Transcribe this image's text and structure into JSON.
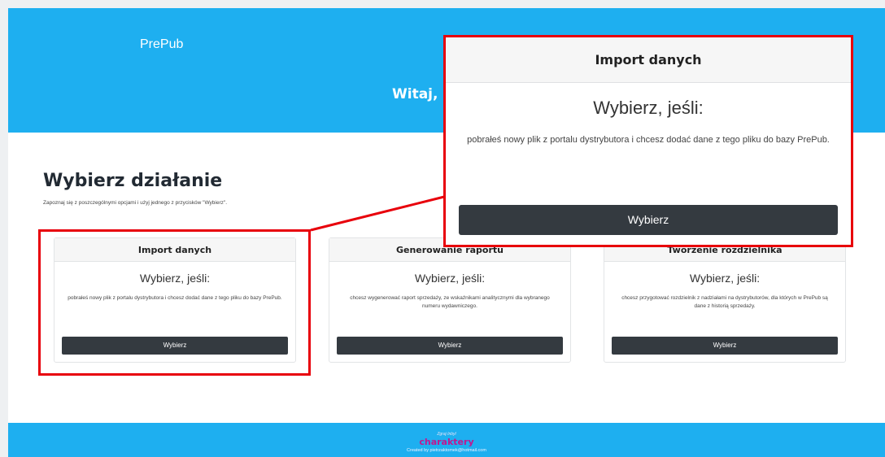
{
  "header": {
    "brand": "PrePub",
    "welcome": "Witaj,"
  },
  "section": {
    "title": "Wybierz działanie",
    "subtitle": "Zapoznaj się z poszczególnymi opcjami i użyj jednego z przycisków \"Wybierz\"."
  },
  "cards": [
    {
      "title": "Import danych",
      "lead": "Wybierz, jeśli:",
      "text": "pobrałeś nowy plik z portalu dystrybutora i chcesz dodać dane z tego pliku do bazy PrePub.",
      "button": "Wybierz"
    },
    {
      "title": "Generowanie raportu",
      "lead": "Wybierz, jeśli:",
      "text": "chcesz wygenerować raport sprzedaży, ze wskaźnikami analitycznymi dla wybranego numeru wydawniczego.",
      "button": "Wybierz"
    },
    {
      "title": "Tworzenie rozdzielnika",
      "lead": "Wybierz, jeśli:",
      "text": "chcesz przygotować rozdzielnik z nadziałami na dystrybutorów, dla których w PrePub są dane z historią sprzedaży.",
      "button": "Wybierz"
    }
  ],
  "zoom": {
    "title": "Import danych",
    "lead": "Wybierz, jeśli:",
    "text": "pobrałeś nowy plik z portalu dystrybutora i chcesz dodać dane z tego pliku do bazy PrePub.",
    "button": "Wybierz"
  },
  "footer": {
    "small": "Zgraj Inbyl",
    "logo": "charaktery",
    "credit": "Created by pietrzaktomek@hotmail.com"
  },
  "colors": {
    "brand_blue": "#1eaff0",
    "button_dark": "#343a40",
    "highlight_red": "#e8000b",
    "logo_magenta": "#c01890"
  }
}
